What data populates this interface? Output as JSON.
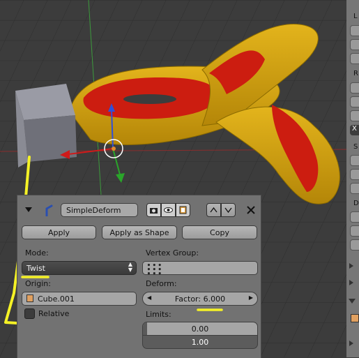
{
  "modifier": {
    "name": "SimpleDeform",
    "buttons": {
      "apply": "Apply",
      "apply_as_shape": "Apply as Shape",
      "copy": "Copy"
    },
    "mode": {
      "label": "Mode:",
      "value": "Twist"
    },
    "vertex_group": {
      "label": "Vertex Group:",
      "value": ""
    },
    "origin": {
      "label": "Origin:",
      "value": "Cube.001"
    },
    "relative": {
      "label": "Relative",
      "checked": false
    },
    "deform": {
      "label": "Deform:",
      "factor_label": "Factor:",
      "factor_value": "6.000"
    },
    "limits": {
      "label": "Limits:",
      "low": "0.00",
      "high": "1.00"
    }
  },
  "right_panel": {
    "labels": [
      "L",
      "R",
      "S",
      "D"
    ],
    "selected_label": "X"
  },
  "colors": {
    "object_yellow": "#d2a316",
    "object_red": "#cc1d10",
    "cube_gray": "#7a7b85",
    "annotation_yellow": "#f5f226",
    "panel_bg": "#727272"
  },
  "icons": [
    "modifier-collapse-icon",
    "simple-deform-icon",
    "render-icon",
    "viewport-visibility-icon",
    "editmode-icon",
    "move-up-icon",
    "move-down-icon",
    "delete-icon",
    "object-icon",
    "vertex-group-icon"
  ]
}
